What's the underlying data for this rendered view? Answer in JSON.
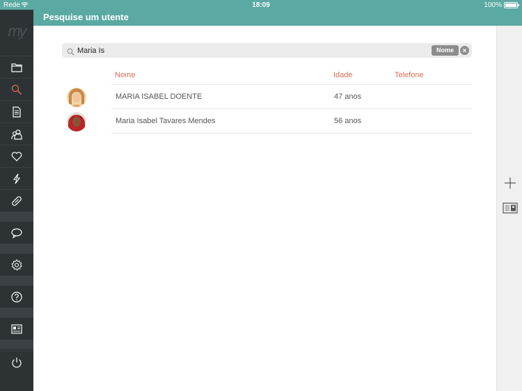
{
  "status_bar": {
    "carrier": "Rede",
    "time": "18:09",
    "battery": "100%"
  },
  "header": {
    "title": "Pesquise um utente"
  },
  "sidebar": {
    "logo": "my",
    "items": [
      {
        "name": "folder-icon",
        "active": false
      },
      {
        "name": "search-icon",
        "active": true
      },
      {
        "name": "document-icon",
        "active": false
      },
      {
        "name": "users-icon",
        "active": false
      },
      {
        "name": "heart-icon",
        "active": false
      },
      {
        "name": "lightning-icon",
        "active": false
      },
      {
        "name": "pill-icon",
        "active": false
      },
      {
        "name": "chat-bubble-icon",
        "active": false
      },
      {
        "name": "gear-icon",
        "active": false
      },
      {
        "name": "help-icon",
        "active": false
      },
      {
        "name": "newspaper-icon",
        "active": false
      },
      {
        "name": "power-icon",
        "active": false
      }
    ],
    "active_color": "#e06a55"
  },
  "search": {
    "value": "Maria Is",
    "scope": "Nome"
  },
  "table": {
    "columns": [
      "Nome",
      "Idade",
      "Telefone"
    ],
    "rows": [
      {
        "name": "MARIA ISABEL DOENTE",
        "age": "47 anos",
        "phone": ""
      },
      {
        "name": "Maria Isabel Tavares Mendes",
        "age": "56 anos",
        "phone": ""
      }
    ]
  },
  "right_rail": {
    "actions": [
      "plus-icon",
      "id-card-icon"
    ]
  },
  "colors": {
    "header_teal": "#5aa9a3",
    "accent": "#e06a55",
    "sidebar_bg": "#2d3235"
  }
}
